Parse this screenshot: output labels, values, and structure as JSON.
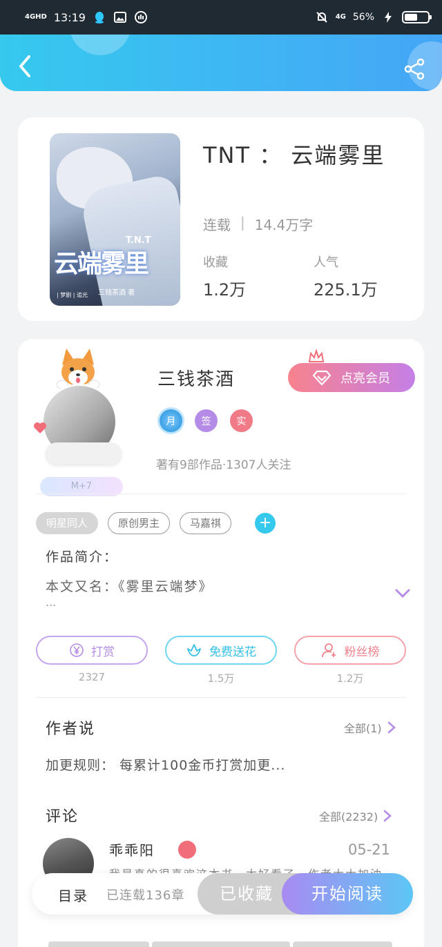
{
  "status_bar": {
    "network": "4GHD",
    "time": "13:19",
    "signal_right": "4G",
    "battery": "56%",
    "battery_level": 0.56,
    "icons": [
      "qq-icon",
      "image-icon",
      "hand-icon",
      "bell-mute-icon",
      "charging-icon"
    ]
  },
  "header": {
    "back_icon": "chevron-left-icon",
    "share_icon": "share-icon"
  },
  "book": {
    "title": "TNT ： 云端雾里",
    "status": "连载",
    "word_count": "14.4万字",
    "favorites_label": "收藏",
    "favorites_value": "1.2万",
    "popularity_label": "人气",
    "popularity_value": "225.1万",
    "cover": {
      "title": "云端雾里",
      "tag": "T.N.T",
      "subtitle": "三钱茶酒 著",
      "meta": "| 梦剧 | 追光"
    }
  },
  "author": {
    "name": "三钱茶酒",
    "vip_button": "点亮会员",
    "level": "M+7",
    "badges": [
      "月",
      "签",
      "实"
    ],
    "info": "著有9部作品·1307人关注"
  },
  "tags": [
    "明星同人",
    "原创男主",
    "马嘉祺"
  ],
  "intro": {
    "heading": "作品简介：",
    "text": "本文又名：《雾里云端梦》",
    "more": "..."
  },
  "actions": [
    {
      "label": "打赏",
      "count": "2327",
      "icon": "yen-icon"
    },
    {
      "label": "免费送花",
      "count": "1.5万",
      "icon": "flower-icon"
    },
    {
      "label": "粉丝榜",
      "count": "1.2万",
      "icon": "user-icon"
    }
  ],
  "author_says": {
    "heading": "作者说",
    "more": "全部(1)",
    "text": "加更规则： 每累计100金币打赏加更..."
  },
  "comments": {
    "heading": "评论",
    "more": "全部(2232)",
    "first": {
      "user": "乖乖阳",
      "date": "05-21",
      "text": "我是真的很喜欢这本书，太好看了，作者大大加油"
    }
  },
  "bottom": {
    "toc": "目录",
    "chapters": "已连载136章",
    "favorited": "已收藏",
    "read": "开始阅读"
  },
  "colors": {
    "header_start": "#35c9ee",
    "header_end": "#44a6f6",
    "purple": "#b48be6",
    "cyan": "#35c9ee",
    "pink": "#f0828d"
  }
}
